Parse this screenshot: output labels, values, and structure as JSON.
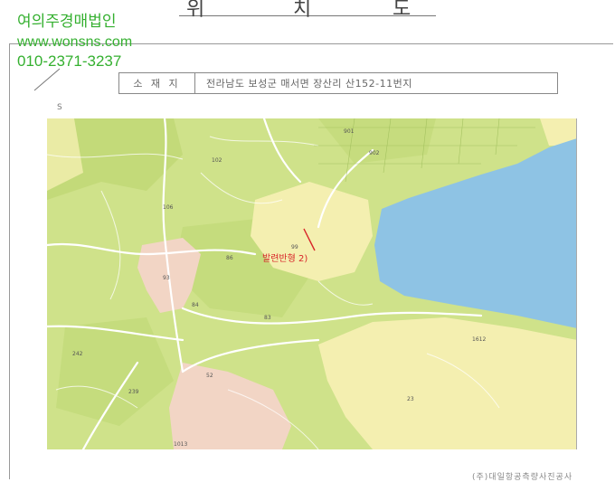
{
  "document": {
    "title_chars": [
      "위",
      "치",
      "도"
    ],
    "address_label": "소 재 지",
    "address_value": "전라남도 보성군 매서면 장산리 산152-11번지",
    "scale_mark": "S",
    "footer_credit": "(주)대일항공측량사진공사"
  },
  "watermark": {
    "company": "여의주경매법인",
    "website": "www.wonsns.com",
    "phone": "010-2371-3237"
  },
  "map": {
    "subject_label": "발련반형 2)",
    "parcel_labels": [
      "901",
      "902",
      "102",
      "106",
      "86",
      "93",
      "84",
      "83",
      "99",
      "242",
      "239",
      "52",
      "1013",
      "23",
      "1612"
    ],
    "colors": {
      "forest": "#cfe28a",
      "forest_dark": "#b9d46c",
      "field": "#f4efb0",
      "sea": "#8ec3e4",
      "village": "#f2d5c5",
      "road": "#ffffff",
      "subject_text": "#d8262a"
    }
  }
}
